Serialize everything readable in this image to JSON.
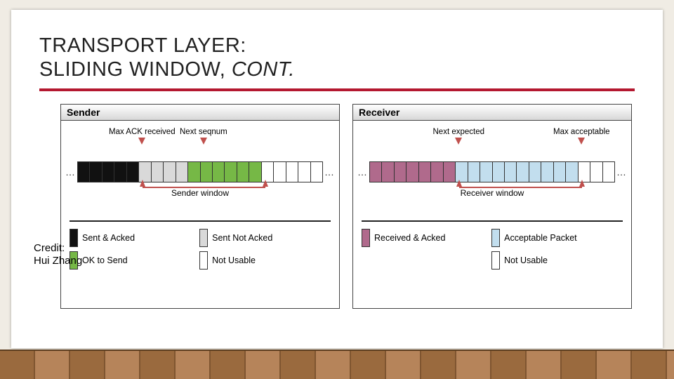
{
  "title_line1": "TRANSPORT LAYER:",
  "title_line2": "SLIDING WINDOW, ",
  "title_cont": "CONT.",
  "credit_line1": "Credit:",
  "credit_line2": "Hui Zhang",
  "sender": {
    "header": "Sender",
    "pointer_left": "Max ACK received",
    "pointer_right": "Next seqnum",
    "window_label": "Sender window",
    "legend": [
      {
        "label": "Sent & Acked",
        "color": "c-black"
      },
      {
        "label": "Sent Not Acked",
        "color": "c-grey"
      },
      {
        "label": "OK to Send",
        "color": "c-green"
      },
      {
        "label": "Not Usable",
        "color": "c-wht"
      }
    ],
    "segments": [
      "c-black",
      "c-black",
      "c-black",
      "c-black",
      "c-black",
      "c-grey",
      "c-grey",
      "c-grey",
      "c-grey",
      "c-green",
      "c-green",
      "c-green",
      "c-green",
      "c-green",
      "c-green",
      "c-wht",
      "c-wht",
      "c-wht",
      "c-wht",
      "c-wht"
    ],
    "pointer_left_idx": 5,
    "pointer_right_idx": 10,
    "window_start_idx": 5,
    "window_end_idx": 15
  },
  "receiver": {
    "header": "Receiver",
    "pointer_left": "Next expected",
    "pointer_right": "Max acceptable",
    "window_label": "Receiver window",
    "legend": [
      {
        "label": "Received & Acked",
        "color": "c-mauve"
      },
      {
        "label": "Acceptable Packet",
        "color": "c-blue"
      },
      {
        "label": "",
        "color": ""
      },
      {
        "label": "Not Usable",
        "color": "c-wht"
      }
    ],
    "segments": [
      "c-mauve",
      "c-mauve",
      "c-mauve",
      "c-mauve",
      "c-mauve",
      "c-mauve",
      "c-mauve",
      "c-blue",
      "c-blue",
      "c-blue",
      "c-blue",
      "c-blue",
      "c-blue",
      "c-blue",
      "c-blue",
      "c-blue",
      "c-blue",
      "c-wht",
      "c-wht",
      "c-wht"
    ],
    "pointer_left_idx": 7,
    "pointer_right_idx": 17,
    "window_start_idx": 7,
    "window_end_idx": 17
  },
  "ellipsis": "…"
}
